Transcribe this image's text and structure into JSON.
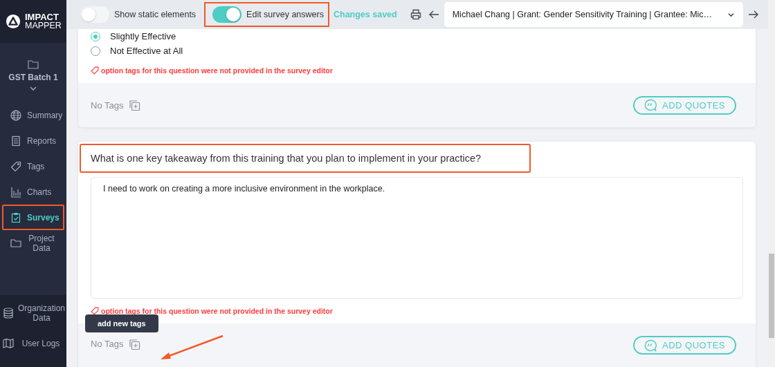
{
  "logo": {
    "line_1": "IMPACT",
    "line_2": "MAPPER"
  },
  "project": {
    "name": "GST Batch 1"
  },
  "sidebar": {
    "items": [
      {
        "label": "Summary",
        "kind": "globe",
        "selected": false,
        "highlighted": false
      },
      {
        "label": "Reports",
        "kind": "document",
        "selected": false,
        "highlighted": false
      },
      {
        "label": "Tags",
        "kind": "tag",
        "selected": false,
        "highlighted": false
      },
      {
        "label": "Charts",
        "kind": "chart",
        "selected": false,
        "highlighted": false
      },
      {
        "label": "Surveys",
        "kind": "clipboard",
        "selected": true,
        "highlighted": true
      },
      {
        "label": "Project Data",
        "kind": "folder",
        "selected": false,
        "highlighted": false
      }
    ],
    "bottom_items": [
      {
        "label": "Organization Data",
        "kind": "database"
      },
      {
        "label": "User Logs",
        "kind": "book"
      }
    ]
  },
  "toolbar": {
    "toggles": [
      {
        "label": "Show static elements",
        "on": false,
        "highlighted": false
      },
      {
        "label": "Edit survey answers",
        "on": true,
        "highlighted": true
      }
    ],
    "status": "Changes saved",
    "respondent": "Michael Chang | Grant: Gender Sensitivity Training | Grantee: Mic…"
  },
  "questions": [
    {
      "kind": "choice",
      "options": [
        {
          "label": "Slightly Effective",
          "selected": true
        },
        {
          "label": "Not Effective at All",
          "selected": false
        }
      ],
      "warning": "option tags for this question were not provided in the survey editor",
      "tags_label": "No Tags",
      "quotes_button": "ADD QUOTES"
    },
    {
      "kind": "text",
      "question": "What is one key takeaway from this training that you plan to implement in your practice?",
      "highlighted": true,
      "answer": "I need to work on creating a more inclusive environment in the workplace.",
      "warning": "option tags for this question were not provided in the survey editor",
      "tags_label": "No Tags",
      "quotes_button": "ADD QUOTES",
      "tooltip": "add new tags"
    }
  ]
}
